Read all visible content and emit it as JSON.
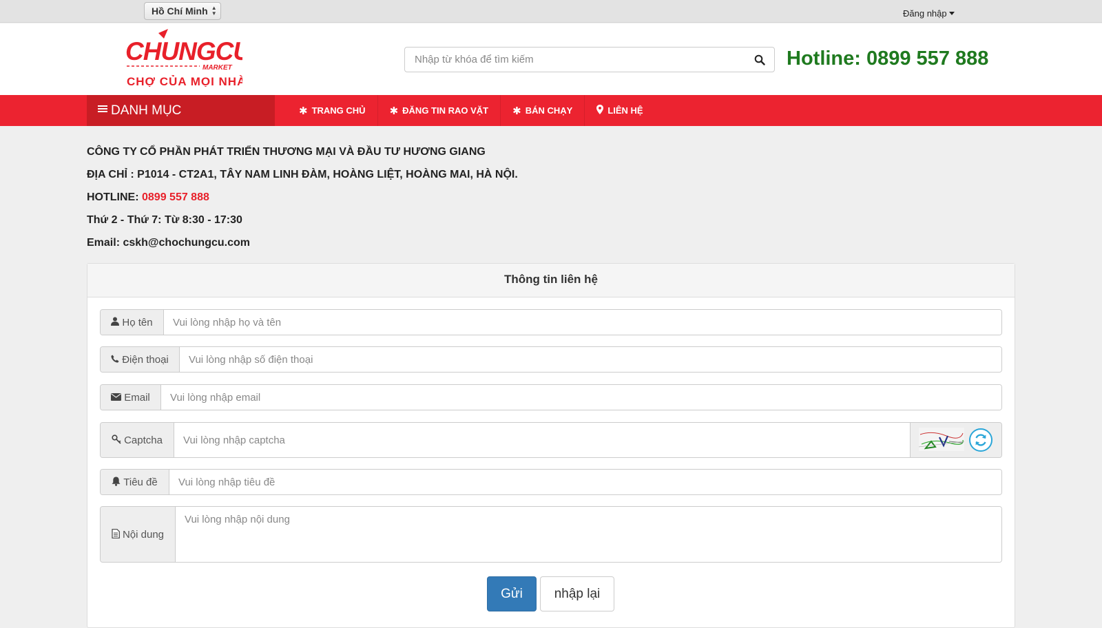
{
  "topbar": {
    "city": "Hồ Chí Minh",
    "login_label": "Đăng nhập"
  },
  "header": {
    "logo_text": "CHUNGCU",
    "logo_sub": "MARKET",
    "logo_slogan": "CHỢ CỦA MỌI NHÀ",
    "search_placeholder": "Nhập từ khóa để tìm kiếm",
    "hotline": "Hotline: 0899 557 888"
  },
  "nav": {
    "category_label": "DANH MỤC",
    "items": [
      {
        "label": "TRANG CHỦ",
        "icon": "asterisk-icon"
      },
      {
        "label": "ĐĂNG TIN RAO VẶT",
        "icon": "asterisk-icon"
      },
      {
        "label": "BÁN CHẠY",
        "icon": "asterisk-icon"
      },
      {
        "label": "LIÊN HỆ",
        "icon": "map-marker-icon"
      }
    ]
  },
  "company": {
    "name": "CÔNG TY CỔ PHẦN PHÁT TRIỂN THƯƠNG MẠI VÀ ĐẦU TƯ HƯƠNG GIANG",
    "address": "ĐỊA CHỈ : P1014 - CT2A1, TÂY NAM LINH ĐÀM, HOÀNG LIỆT, HOÀNG MAI, HÀ NỘI.",
    "hotline_label": "HOTLINE:",
    "hotline_number": "0899 557 888",
    "hours": "Thứ 2 - Thứ 7: Từ 8:30 - 17:30",
    "email": "Email: cskh@chochungcu.com"
  },
  "form": {
    "title": "Thông tin liên hệ",
    "fields": {
      "name": {
        "label": "Họ tên",
        "placeholder": "Vui lòng nhập họ và tên"
      },
      "phone": {
        "label": "Điện thoại",
        "placeholder": "Vui lòng nhập số điện thoại"
      },
      "email": {
        "label": "Email",
        "placeholder": "Vui lòng nhập email"
      },
      "captcha": {
        "label": "Captcha",
        "placeholder": "Vui lòng nhập captcha"
      },
      "subject": {
        "label": "Tiêu đề",
        "placeholder": "Vui lòng nhập tiêu đề"
      },
      "content": {
        "label": "Nội dung",
        "placeholder": "Vui lòng nhập nội dung"
      }
    },
    "submit_label": "Gửi",
    "reset_label": "nhập lại"
  },
  "colors": {
    "nav_red": "#ec2330",
    "category_red": "#c81d24",
    "hotline_green": "#1f7a1f",
    "submit_blue": "#337ab7"
  }
}
